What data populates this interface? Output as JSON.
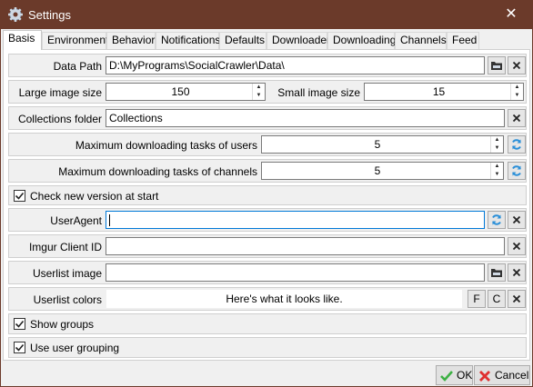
{
  "window": {
    "title": "Settings",
    "close_glyph": "✕"
  },
  "tabs": [
    "Basis",
    "Environment",
    "Behavior",
    "Notifications",
    "Defaults",
    "Downloader",
    "Downloading",
    "Channels",
    "Feed"
  ],
  "basis": {
    "data_path": {
      "label": "Data Path",
      "value": "D:\\MyPrograms\\SocialCrawler\\Data\\"
    },
    "large_image": {
      "label": "Large image size",
      "value": "150"
    },
    "small_image": {
      "label": "Small image size",
      "value": "15"
    },
    "collections": {
      "label": "Collections folder",
      "value": "Collections"
    },
    "max_users": {
      "label": "Maximum downloading tasks of users",
      "value": "5"
    },
    "max_channels": {
      "label": "Maximum downloading tasks of channels",
      "value": "5"
    },
    "check_version": {
      "label": "Check new version at start",
      "checked": true
    },
    "user_agent": {
      "label": "UserAgent",
      "value": ""
    },
    "imgur": {
      "label": "Imgur Client ID",
      "value": ""
    },
    "userlist_image": {
      "label": "Userlist image",
      "value": ""
    },
    "userlist_colors": {
      "label": "Userlist colors",
      "preview": "Here's what it looks like.",
      "btn_f": "F",
      "btn_c": "C"
    },
    "show_groups": {
      "label": "Show groups",
      "checked": true
    },
    "user_grouping": {
      "label": "Use user grouping",
      "checked": true
    }
  },
  "footer": {
    "ok": "OK",
    "cancel": "Cancel"
  },
  "colors": {
    "titlebar": "#6b3a2a",
    "ok_icon": "#3cb043",
    "cancel_icon": "#e03030",
    "refresh_icon": "#2a8fd8"
  }
}
